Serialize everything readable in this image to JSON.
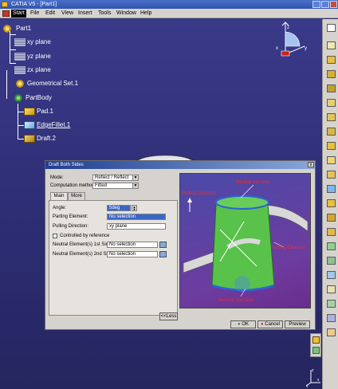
{
  "window": {
    "title": "CATIA V5 - [Part1]"
  },
  "menu": {
    "items": [
      "Start",
      "File",
      "Edit",
      "View",
      "Insert",
      "Tools",
      "Window",
      "Help"
    ]
  },
  "tree": {
    "root": "Part1",
    "items": [
      {
        "label": "xy plane",
        "icon": "plane-icon"
      },
      {
        "label": "yz plane",
        "icon": "plane-icon"
      },
      {
        "label": "zx plane",
        "icon": "plane-icon"
      },
      {
        "label": "Geometrical Set.1",
        "icon": "gear-icon"
      },
      {
        "label": "PartBody",
        "icon": "body-icon"
      },
      {
        "label": "Pad.1",
        "icon": "pad-icon"
      },
      {
        "label": "EdgeFillet.1",
        "icon": "fillet-icon"
      },
      {
        "label": "Draft.2",
        "icon": "draft-icon"
      }
    ]
  },
  "dialog": {
    "title": "Draft Both Sides",
    "close_label": "x",
    "mode_label": "Mode:",
    "mode_value": "Reflect / Reflect",
    "computation_label": "Computation method:",
    "computation_value": "Fitted",
    "tabs": [
      "Main",
      "More"
    ],
    "angle_label": "Angle:",
    "angle_value": "5deg",
    "parting_label": "Parting Element:",
    "parting_value": "No selection",
    "pulling_label": "Pulling Direction:",
    "pulling_value": "xy plane",
    "controlled_label": "Controlled by reference",
    "neutral1_label": "Neutral Element(s) 1st Side:",
    "neutral1_value": "No selection",
    "neutral2_label": "Neutral Element(s) 2nd Side:",
    "neutral2_value": "No selection",
    "less_label": "<<Less",
    "ok_label": "OK",
    "cancel_label": "Cancel",
    "preview_label": "Preview",
    "preview": {
      "neutral1": "Neutral 1st side",
      "pulling": "Pulling Direction",
      "parting": "Parting Element",
      "neutral2": "Neutral 2nd side"
    }
  },
  "compass": {
    "x": "x",
    "y": "y",
    "z": "z"
  },
  "axis_bottom": {
    "x": "x",
    "y": "y",
    "z": "z"
  },
  "colors": {
    "viewport": "#2f2f6e",
    "accent": "#3a66c8",
    "dialog": "#d6d3ce"
  }
}
